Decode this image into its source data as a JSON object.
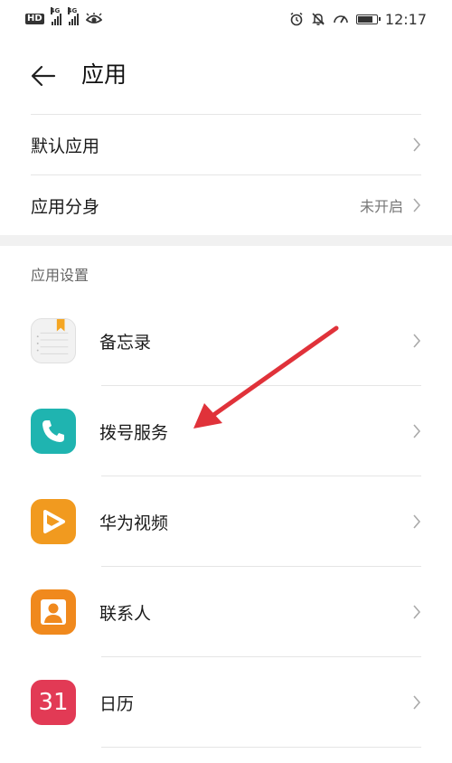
{
  "status_bar": {
    "hd_label": "HD",
    "sim1_label": "4G",
    "sim2_label": "4G",
    "time": "12:17",
    "battery_level": 0.85,
    "icons": [
      "hd-icon",
      "signal-icon",
      "signal-icon",
      "eye-icon",
      "alarm-icon",
      "mute-icon",
      "speed-icon",
      "battery-icon"
    ]
  },
  "header": {
    "title": "应用"
  },
  "settings": {
    "default_apps": {
      "label": "默认应用"
    },
    "app_twin": {
      "label": "应用分身",
      "value": "未开启"
    }
  },
  "section": {
    "label": "应用设置"
  },
  "apps": [
    {
      "label": "备忘录",
      "icon": "memo-icon"
    },
    {
      "label": "拨号服务",
      "icon": "phone-icon"
    },
    {
      "label": "华为视频",
      "icon": "video-icon"
    },
    {
      "label": "联系人",
      "icon": "contacts-icon"
    },
    {
      "label": "日历",
      "icon": "calendar-icon",
      "icon_text": "31"
    }
  ],
  "annotation": {
    "color": "#e0323a"
  }
}
